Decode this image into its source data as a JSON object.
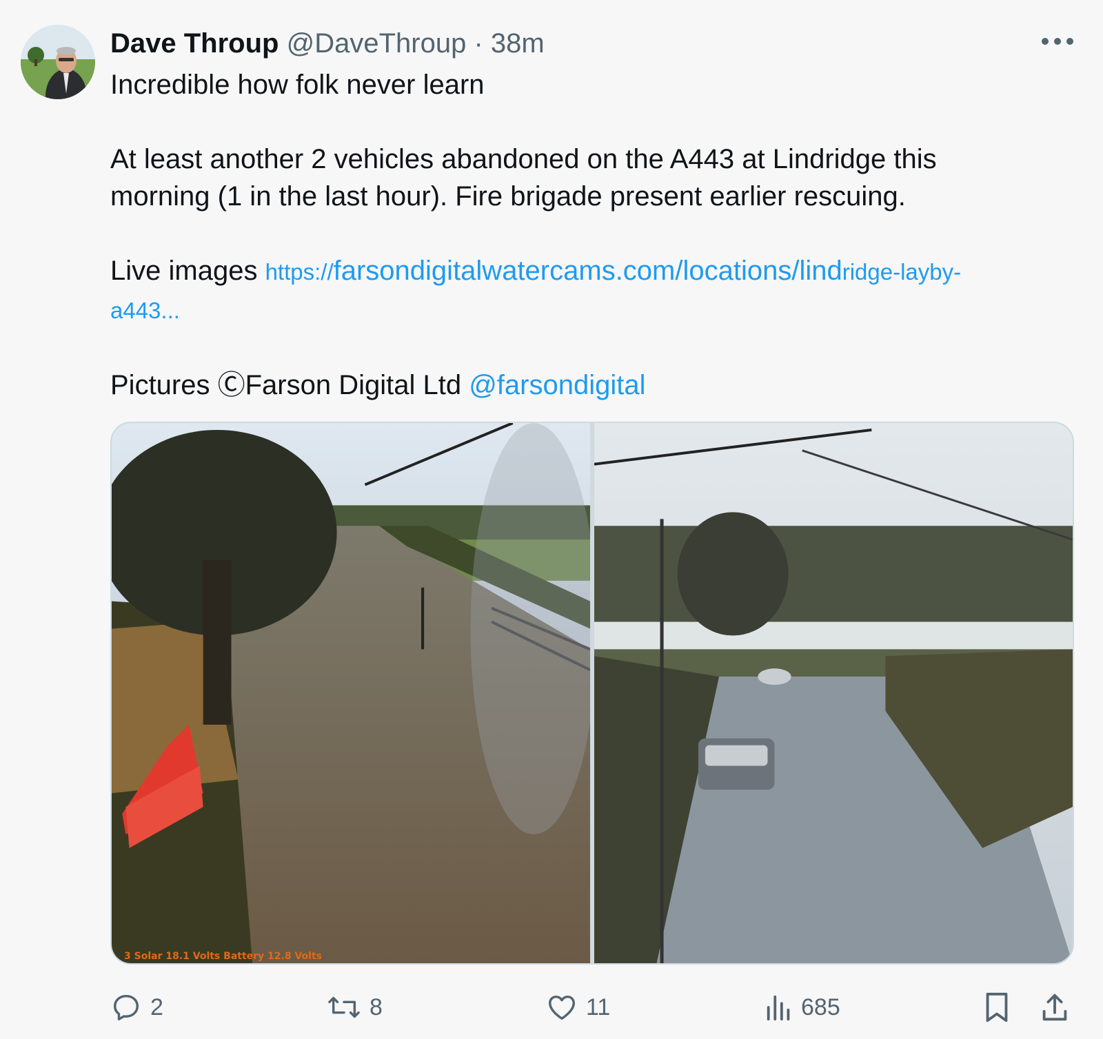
{
  "tweet": {
    "author_name": "Dave Throup",
    "handle": "@DaveThroup",
    "separator": "·",
    "time": "38m",
    "line1": "Incredible how folk never learn",
    "line2": "At least another 2 vehicles abandoned on the A443 at Lindridge this",
    "line3": "morning (1 in the last hour). Fire brigade present earlier rescuing.",
    "live_label": "Live images ",
    "link_a": "https://",
    "link_b": "farsondigitalwatercams.com/locations/lind",
    "link_c": "ridge-layby-",
    "link_d": "a443...",
    "pictures_label": "Pictures ",
    "copyright_text": "Ⓒ",
    "farson_text": "Farson Digital Ltd ",
    "mention": "@farsondigital"
  },
  "media": {
    "photo1_overlay": "3 Solar 18.1 Volts   Battery 12.8 Volts"
  },
  "actions": {
    "replies": "2",
    "reposts": "8",
    "likes": "11",
    "views": "685"
  },
  "icons": {
    "more": "more-dots-icon",
    "reply": "reply-icon",
    "repost": "repost-icon",
    "like": "heart-icon",
    "views": "views-chart-icon",
    "bookmark": "bookmark-icon",
    "share": "share-icon"
  },
  "colors": {
    "link": "#1d9bf0",
    "secondary_text": "#536471",
    "primary_text": "#0f1419",
    "background": "#f7f7f7"
  }
}
